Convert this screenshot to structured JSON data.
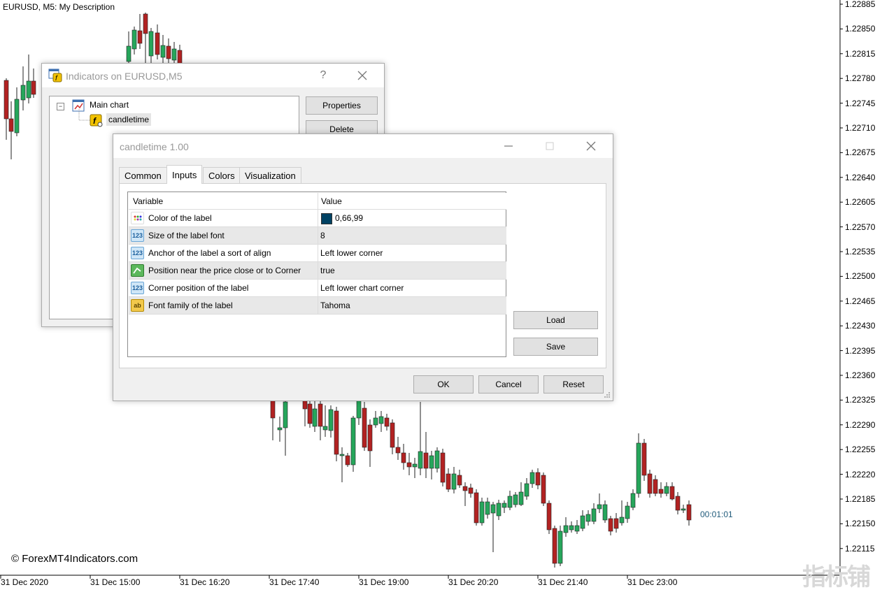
{
  "chart": {
    "title": "EURUSD, M5:  My Description",
    "price_labels": [
      "1.22885",
      "1.22850",
      "1.22815",
      "1.22780",
      "1.22745",
      "1.22710",
      "1.22675",
      "1.22640",
      "1.22605",
      "1.22570",
      "1.22535",
      "1.22500",
      "1.22465",
      "1.22430",
      "1.22395",
      "1.22360",
      "1.22325",
      "1.22290",
      "1.22255",
      "1.22220",
      "1.22185",
      "1.22150",
      "1.22115"
    ],
    "time_labels": [
      "31 Dec 2020",
      "31 Dec 15:00",
      "31 Dec 16:20",
      "31 Dec 17:40",
      "31 Dec 19:00",
      "31 Dec 20:20",
      "31 Dec 21:40",
      "31 Dec 23:00"
    ],
    "timer": "00:01:01",
    "copyright": "© ForexMT4Indicators.com",
    "watermark": "指标铺"
  },
  "indicators_window": {
    "title": "Indicators on EURUSD,M5",
    "help": "?",
    "tree": {
      "root": "Main chart",
      "child": "candletime"
    },
    "buttons": {
      "properties": "Properties",
      "delete": "Delete"
    }
  },
  "candletime_dialog": {
    "title": "candletime 1.00",
    "tabs": [
      "Common",
      "Inputs",
      "Colors",
      "Visualization"
    ],
    "active_tab": "Inputs",
    "grid_headers": {
      "variable": "Variable",
      "value": "Value"
    },
    "rows": [
      {
        "icon": "palette-icon",
        "variable": "Color of the label",
        "value": "0,66,99",
        "swatch": "#004263"
      },
      {
        "icon": "number-icon",
        "variable": "Size of the label font",
        "value": "8"
      },
      {
        "icon": "number-icon",
        "variable": "Anchor of the label a sort of align",
        "value": "Left lower corner"
      },
      {
        "icon": "boolean-icon",
        "variable": "Position near the price close or to Corner",
        "value": "true"
      },
      {
        "icon": "number-icon",
        "variable": "Corner position of the label",
        "value": "Left lower chart corner"
      },
      {
        "icon": "text-icon",
        "variable": "Font family of the label",
        "value": "Tahoma"
      }
    ],
    "buttons": {
      "load": "Load",
      "save": "Save",
      "ok": "OK",
      "cancel": "Cancel",
      "reset": "Reset"
    }
  },
  "colors": {
    "bull": "#26a65b",
    "bear": "#b22222",
    "accent": "#004263"
  }
}
